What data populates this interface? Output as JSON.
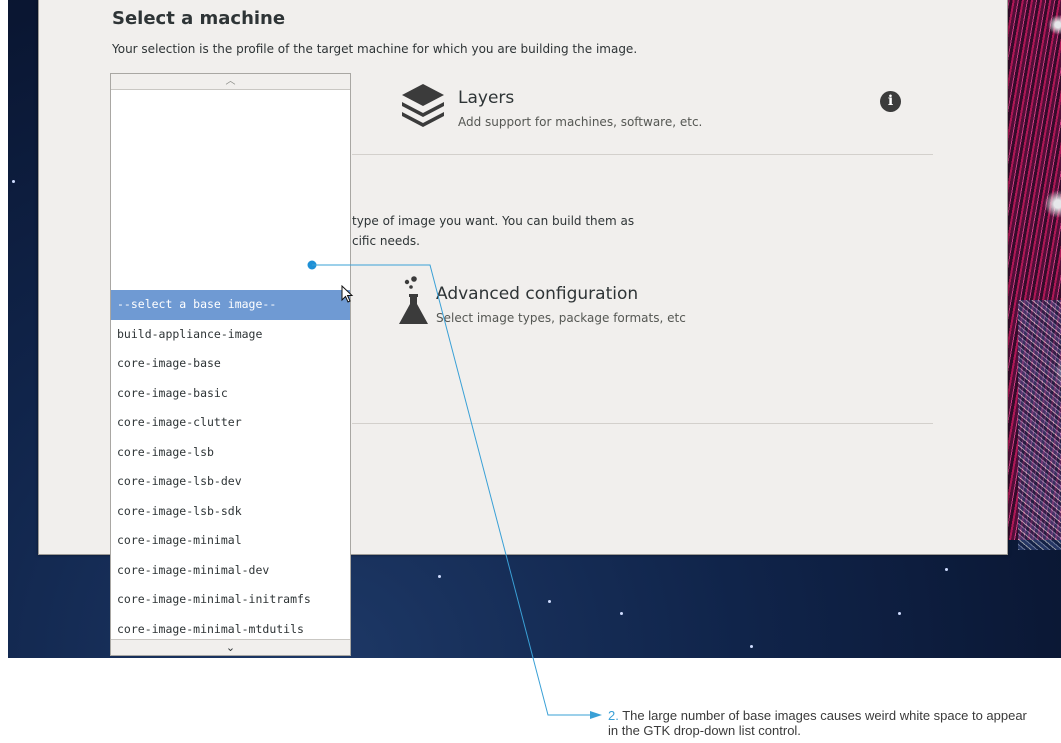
{
  "header": {
    "title": "Select a machine",
    "subtitle": "Your selection is the profile of the target machine for which you are building the image."
  },
  "layers": {
    "title": "Layers",
    "description": "Add support for machines, software, etc.",
    "icon": "layers-icon",
    "info_icon_glyph": "i"
  },
  "image_section": {
    "description_line1": "type of image you want. You can build them as",
    "description_line2": "cific needs."
  },
  "advanced": {
    "title": "Advanced configuration",
    "description": "Select image types, package formats, etc",
    "icon": "flask-icon"
  },
  "dropdown": {
    "scroll_up_glyph": "︿",
    "scroll_down_glyph": "⌄",
    "items": [
      "--select a base image--",
      "build-appliance-image",
      "core-image-base",
      "core-image-basic",
      "core-image-clutter",
      "core-image-lsb",
      "core-image-lsb-dev",
      "core-image-lsb-sdk",
      "core-image-minimal",
      "core-image-minimal-dev",
      "core-image-minimal-initramfs",
      "core-image-minimal-mtdutils"
    ],
    "selected_index": 0
  },
  "annotation": {
    "number": "2.",
    "text": " The large number of base images causes weird white space to appear in the GTK drop-down list control.",
    "color": "#3aa0d6"
  }
}
